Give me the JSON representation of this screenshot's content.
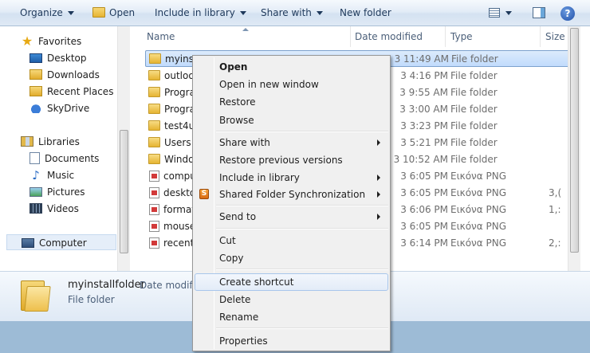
{
  "toolbar": {
    "organize": "Organize",
    "open": "Open",
    "include_in_library": "Include in library",
    "share_with": "Share with",
    "new_folder": "New folder",
    "help": "?"
  },
  "nav": {
    "favorites": "Favorites",
    "desktop": "Desktop",
    "downloads": "Downloads",
    "recent_places": "Recent Places",
    "skydrive": "SkyDrive",
    "libraries": "Libraries",
    "documents": "Documents",
    "music": "Music",
    "pictures": "Pictures",
    "videos": "Videos",
    "computer": "Computer"
  },
  "columns": {
    "name": "Name",
    "date_modified": "Date modified",
    "type": "Type",
    "size": "Size"
  },
  "files": [
    {
      "name": "myinst",
      "date": "3 11:49 AM",
      "type": "File folder",
      "size": "",
      "icon": "folder"
    },
    {
      "name": "outloo",
      "date": "3 4:16 PM",
      "type": "File folder",
      "size": "",
      "icon": "folder"
    },
    {
      "name": "Progra",
      "date": "3 9:55 AM",
      "type": "File folder",
      "size": "",
      "icon": "folder"
    },
    {
      "name": "Progra",
      "date": "3 3:00 AM",
      "type": "File folder",
      "size": "",
      "icon": "folder"
    },
    {
      "name": "test4u_",
      "date": "3 3:23 PM",
      "type": "File folder",
      "size": "",
      "icon": "folder"
    },
    {
      "name": "Users",
      "date": "3 5:21 PM",
      "type": "File folder",
      "size": "",
      "icon": "folder"
    },
    {
      "name": "Windo",
      "date": "3 10:52 AM",
      "type": "File folder",
      "size": "",
      "icon": "folder"
    },
    {
      "name": "compu",
      "date": "3 6:05 PM",
      "type": "Εικόνα PNG",
      "size": "",
      "icon": "png"
    },
    {
      "name": "deskto",
      "date": "3 6:05 PM",
      "type": "Εικόνα PNG",
      "size": "3,(",
      "icon": "png"
    },
    {
      "name": "format",
      "date": "3 6:06 PM",
      "type": "Εικόνα PNG",
      "size": "1,:",
      "icon": "png"
    },
    {
      "name": "mouse",
      "date": "3 6:05 PM",
      "type": "Εικόνα PNG",
      "size": "",
      "icon": "png"
    },
    {
      "name": "recent",
      "date": "3 6:14 PM",
      "type": "Εικόνα PNG",
      "size": "2,:",
      "icon": "png"
    }
  ],
  "details": {
    "name": "myinstallfolder",
    "label": "Date modifi",
    "type": "File folder"
  },
  "context_menu": {
    "open": "Open",
    "open_new_window": "Open in new window",
    "restore": "Restore",
    "browse": "Browse",
    "share_with": "Share with",
    "restore_previous": "Restore previous versions",
    "include_in_library": "Include in library",
    "shared_folder_sync": "Shared Folder Synchronization",
    "send_to": "Send to",
    "cut": "Cut",
    "copy": "Copy",
    "create_shortcut": "Create shortcut",
    "delete": "Delete",
    "rename": "Rename",
    "properties": "Properties"
  }
}
